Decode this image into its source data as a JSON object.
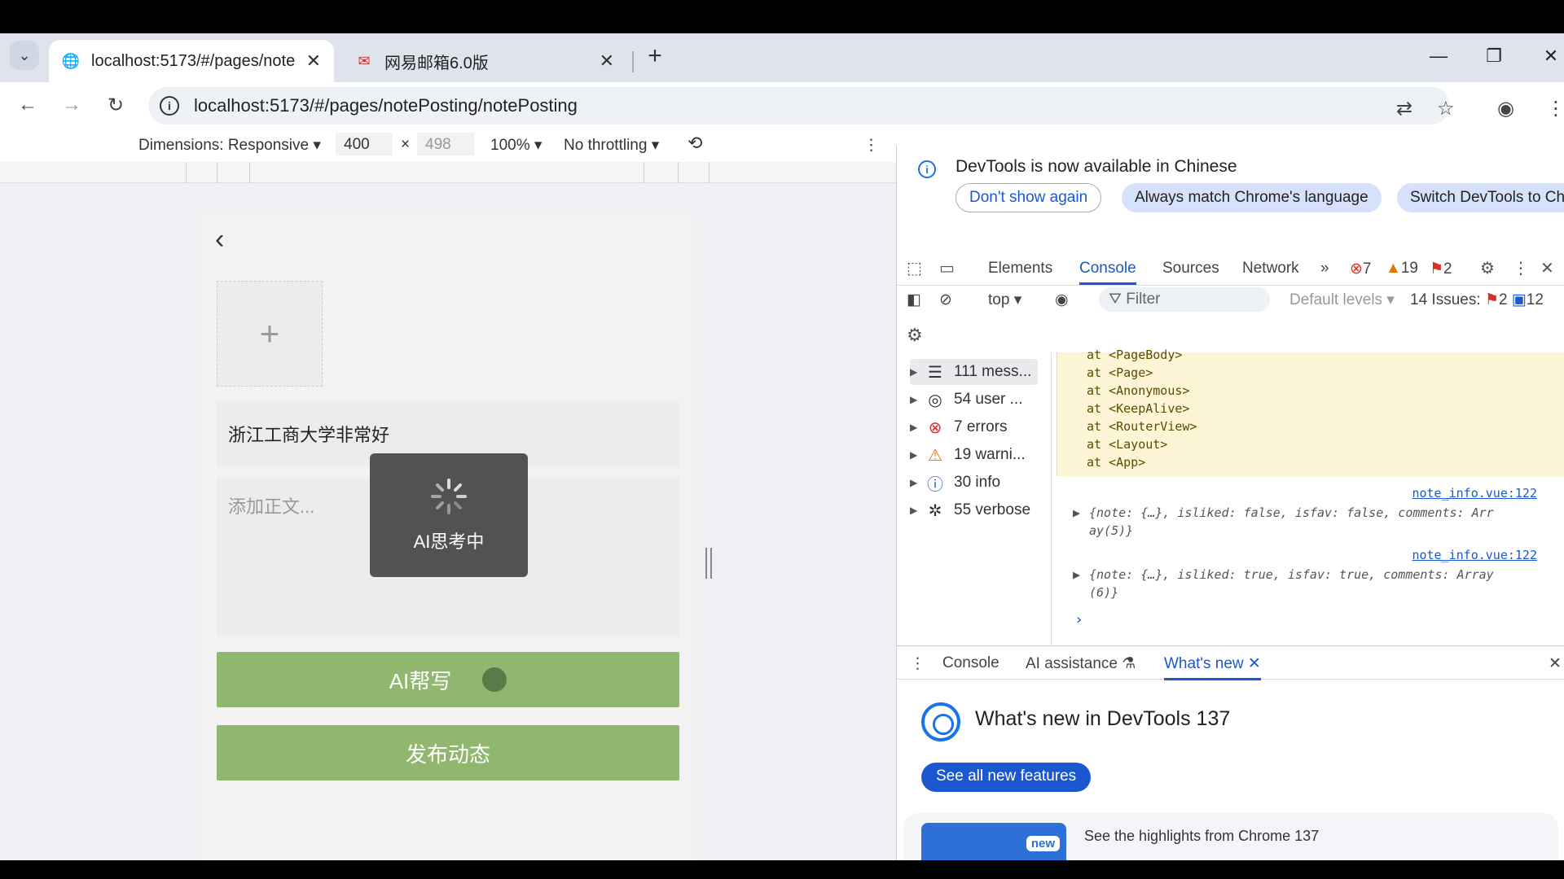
{
  "tabs": [
    {
      "title": "localhost:5173/#/pages/note",
      "active": true
    },
    {
      "title": "网易邮箱6.0版",
      "active": false
    }
  ],
  "toolbar": {
    "url": "localhost:5173/#/pages/notePosting/notePosting"
  },
  "device": {
    "dimensions_label": "Dimensions: Responsive",
    "width": "400",
    "height": "498",
    "zoom": "100%",
    "throttling": "No throttling"
  },
  "app": {
    "title_value": "浙江工商大学非常好",
    "body_placeholder": "添加正文...",
    "upload_plus": "+",
    "ai_button": "AI帮写",
    "publish_button": "发布动态",
    "overlay_text": "AI思考中"
  },
  "devtools": {
    "banner_message": "DevTools is now available in Chinese",
    "banner_buttons": [
      "Don't show again",
      "Always match Chrome's language",
      "Switch DevTools to Ch"
    ],
    "tabs": [
      "Elements",
      "Console",
      "Sources",
      "Network"
    ],
    "active_tab": "Console",
    "error_count": "7",
    "warning_count": "19",
    "issue_flag_count": "2",
    "context": "top",
    "filter_placeholder": "Filter",
    "levels": "Default levels",
    "issues_label": "14 Issues:",
    "issues_err": "2",
    "issues_info": "12",
    "sidebar": [
      {
        "label": "111 mess...",
        "icon": "list-icon"
      },
      {
        "label": "54 user ...",
        "icon": "user-icon"
      },
      {
        "label": "7 errors",
        "icon": "error-icon"
      },
      {
        "label": "19 warni...",
        "icon": "warning-icon"
      },
      {
        "label": "30 info",
        "icon": "info-icon"
      },
      {
        "label": "55 verbose",
        "icon": "bug-icon"
      }
    ],
    "stack": [
      "at <PageBody>",
      "at <Page>",
      "at <Anonymous>",
      "at <KeepAlive>",
      "at <RouterView>",
      "at <Layout>",
      "at <App>"
    ],
    "logs": [
      {
        "source": "note_info.vue:122",
        "line1": "{note: {…}, isliked: false, isfav: false, comments: Arr",
        "line2": "ay(5)}"
      },
      {
        "source": "note_info.vue:122",
        "line1": "{note: {…}, isliked: true, isfav: true, comments: Array",
        "line2": "(6)}"
      }
    ],
    "drawer_tabs": [
      "Console",
      "AI assistance",
      "What's new"
    ],
    "whatsnew_title": "What's new in DevTools 137",
    "see_all": "See all new features",
    "highlight_text": "See the highlights from Chrome 137",
    "new_badge": "new"
  }
}
